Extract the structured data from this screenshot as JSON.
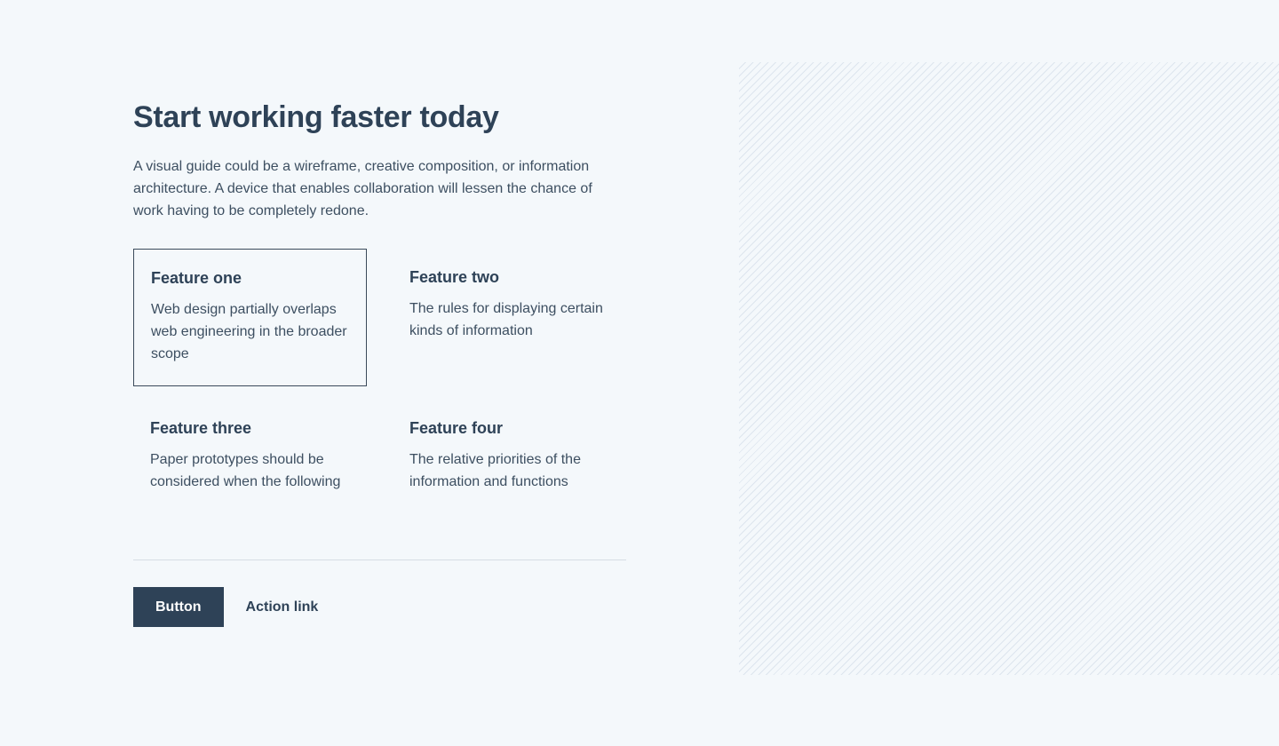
{
  "hero": {
    "title": "Start working faster today",
    "intro": "A visual guide could be a wireframe, creative composition, or information architecture. A device that enables collaboration will lessen the chance of work having to be completely redone."
  },
  "features": [
    {
      "title": "Feature one",
      "description": "Web design partially overlaps web engineering in the broader scope"
    },
    {
      "title": "Feature two",
      "description": "The rules for displaying certain kinds of information"
    },
    {
      "title": "Feature three",
      "description": "Paper prototypes should be considered when the following"
    },
    {
      "title": "Feature four",
      "description": "The relative priorities of the information and functions"
    }
  ],
  "actions": {
    "button_label": "Button",
    "link_label": "Action link"
  },
  "colors": {
    "background": "#f4f8fb",
    "primary": "#2e4257",
    "text": "#3d4f61",
    "hatch": "#dde5ee"
  }
}
